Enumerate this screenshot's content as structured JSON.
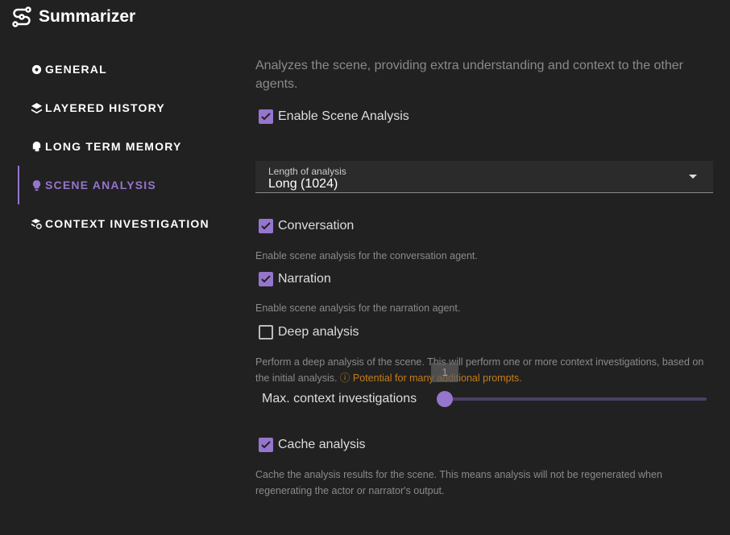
{
  "header": {
    "title": "Summarizer",
    "icon": "flow-icon"
  },
  "nav": {
    "items": [
      {
        "label": "GENERAL",
        "icon": "gear-icon"
      },
      {
        "label": "LAYERED HISTORY",
        "icon": "layers-icon"
      },
      {
        "label": "LONG TERM MEMORY",
        "icon": "brain-icon"
      },
      {
        "label": "SCENE ANALYSIS",
        "icon": "lightbulb-icon",
        "active": true
      },
      {
        "label": "CONTEXT INVESTIGATION",
        "icon": "search-layers-icon"
      }
    ]
  },
  "main": {
    "intro": "Analyzes the scene, providing extra understanding and context to the other agents.",
    "enable": {
      "label": "Enable Scene Analysis",
      "checked": true
    },
    "length": {
      "label": "Length of analysis",
      "value": "Long (1024)"
    },
    "conversation": {
      "label": "Conversation",
      "checked": true,
      "hint": "Enable scene analysis for the conversation agent."
    },
    "narration": {
      "label": "Narration",
      "checked": true,
      "hint": "Enable scene analysis for the narration agent."
    },
    "deep": {
      "label": "Deep analysis",
      "checked": false,
      "hint": "Perform a deep analysis of the scene. This will perform one or more context investigations, based on the initial analysis.",
      "warning": "Potential for many additional prompts."
    },
    "slider": {
      "label": "Max. context investigations",
      "value": "1"
    },
    "cache": {
      "label": "Cache analysis",
      "checked": true,
      "hint": "Cache the analysis results for the scene. This means analysis will not be regenerated when regenerating the actor or narrator's output."
    },
    "accent": "#9575cd"
  }
}
